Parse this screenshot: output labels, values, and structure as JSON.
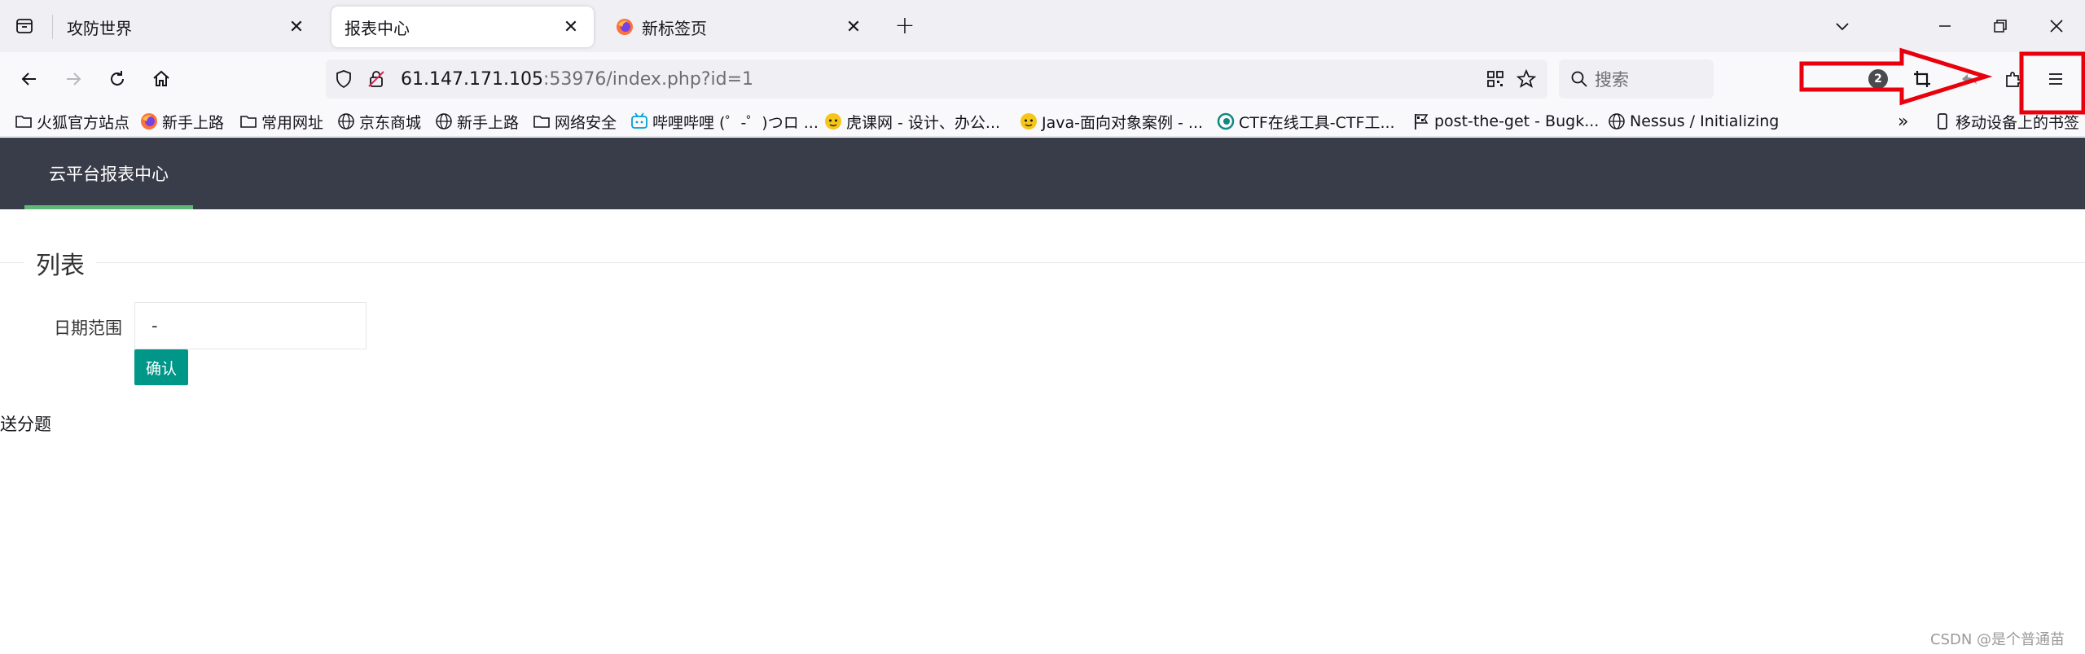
{
  "tabs": [
    {
      "title": "攻防世界",
      "active": false
    },
    {
      "title": "报表中心",
      "active": true
    },
    {
      "title": "新标签页",
      "active": false
    }
  ],
  "tab_close_glyph": "✕",
  "new_tab_glyph": "+",
  "window_controls": {
    "minimize": "—",
    "restore": "⧉",
    "close": "✕",
    "list": "⌄"
  },
  "url": {
    "host": "61.147.171.105",
    "rest": ":53976/index.php?id=1"
  },
  "search": {
    "placeholder": "搜索"
  },
  "extensions_badge": "2",
  "bookmarks": [
    {
      "label": "火狐官方站点",
      "icon": "folder-icon"
    },
    {
      "label": "新手上路",
      "icon": "firefox-icon"
    },
    {
      "label": "常用网址",
      "icon": "folder-icon"
    },
    {
      "label": "京东商城",
      "icon": "globe-icon"
    },
    {
      "label": "新手上路",
      "icon": "globe-icon"
    },
    {
      "label": "网络安全",
      "icon": "folder-icon"
    },
    {
      "label": "哔哩哔哩 (゜-゜)つロ ...",
      "icon": "bilibili-icon"
    },
    {
      "label": "虎课网 - 设计、办公...",
      "icon": "huke-icon"
    },
    {
      "label": "Java-面向对象案例 - ...",
      "icon": "huke-icon"
    },
    {
      "label": "CTF在线工具-CTF工...",
      "icon": "ctf-icon"
    },
    {
      "label": "post-the-get - Bugk...",
      "icon": "flag-icon"
    },
    {
      "label": "Nessus / Initializing",
      "icon": "globe-icon"
    }
  ],
  "bookmarks_overflow": "»",
  "mobile_bookmarks": "移动设备上的书签",
  "page": {
    "nav_title": "云平台报表中心",
    "legend": "列表",
    "date_label": "日期范围",
    "date_value": "-",
    "confirm": "确认",
    "bonus_text": "送分题",
    "watermark": "CSDN @是个普通苗"
  },
  "colors": {
    "header_bg": "#393d49",
    "nav_active": "#5fb878",
    "button": "#009688",
    "annotation": "#e8000d"
  }
}
